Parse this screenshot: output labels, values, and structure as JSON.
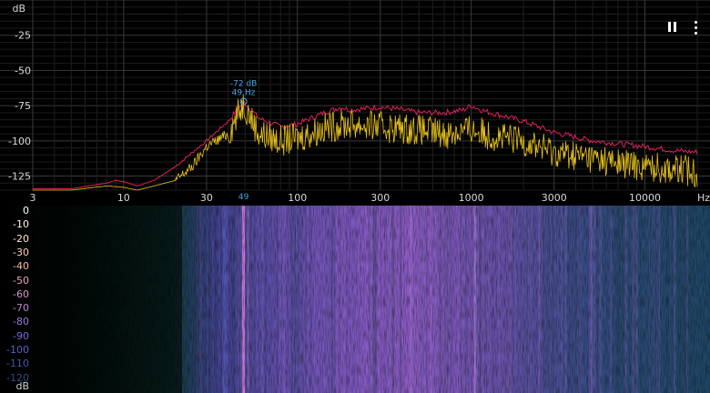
{
  "spectrum": {
    "y_unit": "dB",
    "y_ticks": [
      "-25",
      "-50",
      "-75",
      "-100",
      "-125"
    ],
    "x_unit": "Hz",
    "x_ticks": [
      "3",
      "10",
      "30",
      "100",
      "300",
      "1000",
      "3000",
      "10000"
    ],
    "peak_label_db": "-72 dB",
    "peak_label_hz": "49 Hz",
    "peak_marker": "49"
  },
  "controls": {
    "pause_icon": "pause-icon",
    "menu_icon": "more-vert-icon"
  },
  "spectrogram": {
    "db_unit": "dB",
    "db_ticks": [
      "0",
      "-10",
      "-20",
      "-30",
      "-40",
      "-50",
      "-60",
      "-70",
      "-80",
      "-90",
      "-100",
      "-110",
      "-120"
    ],
    "tick_colors": [
      "#ffffff",
      "#fff8e0",
      "#ffe6c8",
      "#ffd2b0",
      "#f4bba6",
      "#e8a6b8",
      "#d694c8",
      "#bd85d4",
      "#9d77d8",
      "#7c6ad2",
      "#5d60c4",
      "#3f57a8",
      "#2d4d86"
    ]
  },
  "chart_data": {
    "type": "line",
    "xscale": "log",
    "xlim": [
      3,
      20000
    ],
    "ylim": [
      -135,
      0
    ],
    "xlabel": "Hz",
    "ylabel": "dB",
    "series": [
      {
        "color": "#e0205a",
        "x": [
          3,
          5,
          8,
          9,
          10,
          12,
          15,
          20,
          25,
          30,
          40,
          49,
          60,
          80,
          100,
          150,
          180,
          200,
          250,
          300,
          400,
          500,
          700,
          900,
          1000,
          1200,
          1500,
          2000,
          3000,
          5000,
          7000,
          10000,
          15000,
          20000
        ],
        "y": [
          -134,
          -134,
          -130,
          -128,
          -129,
          -132,
          -128,
          -118,
          -108,
          -100,
          -86,
          -72,
          -84,
          -90,
          -88,
          -79,
          -76,
          -78,
          -77,
          -76,
          -78,
          -80,
          -80,
          -78,
          -75,
          -79,
          -82,
          -86,
          -94,
          -100,
          -102,
          -104,
          -107,
          -108
        ]
      },
      {
        "color": "#e8c21c",
        "x": [
          3,
          5,
          8,
          10,
          12,
          15,
          20,
          25,
          30,
          40,
          49,
          60,
          80,
          100,
          150,
          200,
          300,
          500,
          700,
          1000,
          1500,
          2000,
          3000,
          5000,
          7000,
          10000,
          15000,
          20000
        ],
        "y": [
          -135,
          -135,
          -132,
          -133,
          -135,
          -132,
          -128,
          -118,
          -104,
          -95,
          -73,
          -95,
          -100,
          -98,
          -90,
          -88,
          -90,
          -92,
          -95,
          -92,
          -98,
          -100,
          -108,
          -112,
          -116,
          -118,
          -120,
          -122
        ]
      }
    ]
  }
}
